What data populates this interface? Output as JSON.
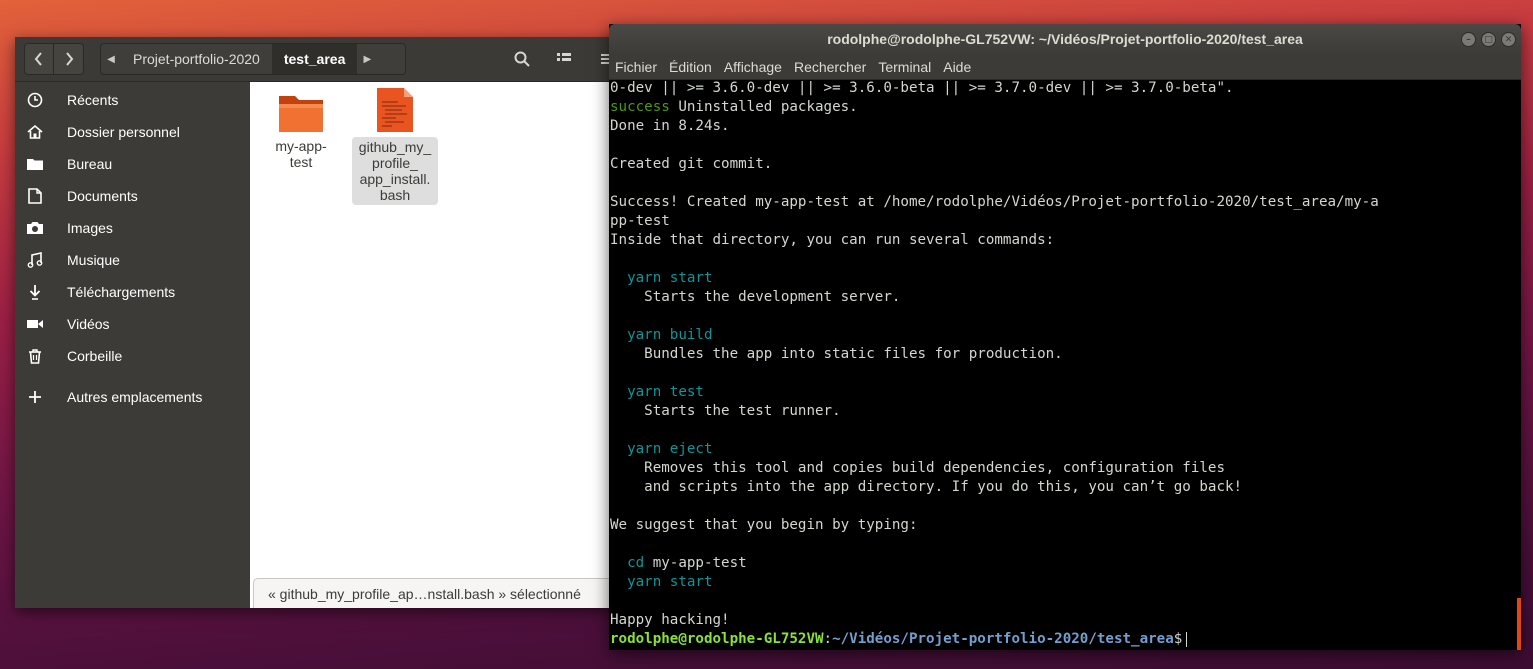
{
  "file_manager": {
    "breadcrumb": [
      "Projet-portfolio-2020",
      "test_area"
    ],
    "sidebar": [
      {
        "label": "Récents",
        "icon": "clock-icon"
      },
      {
        "label": "Dossier personnel",
        "icon": "home-icon"
      },
      {
        "label": "Bureau",
        "icon": "folder-icon"
      },
      {
        "label": "Documents",
        "icon": "document-icon"
      },
      {
        "label": "Images",
        "icon": "camera-icon"
      },
      {
        "label": "Musique",
        "icon": "music-icon"
      },
      {
        "label": "Téléchargements",
        "icon": "download-icon"
      },
      {
        "label": "Vidéos",
        "icon": "video-icon"
      },
      {
        "label": "Corbeille",
        "icon": "trash-icon"
      },
      {
        "label": "Autres emplacements",
        "icon": "plus-icon"
      }
    ],
    "files": [
      {
        "name_line1": "my-app-",
        "name_line2": "test",
        "type": "folder"
      },
      {
        "name_line1": "github_my_",
        "name_line2": "profile_",
        "name_line3": "app_install.",
        "name_line4": "bash",
        "type": "script",
        "selected": true
      }
    ],
    "status": "« github_my_profile_ap…nstall.bash » sélectionné"
  },
  "terminal": {
    "title": "rodolphe@rodolphe-GL752VW: ~/Vidéos/Projet-portfolio-2020/test_area",
    "menu": [
      "Fichier",
      "Édition",
      "Affichage",
      "Rechercher",
      "Terminal",
      "Aide"
    ],
    "lines": {
      "l1": "0-dev || >= 3.6.0-dev || >= 3.6.0-beta || >= 3.7.0-dev || >= 3.7.0-beta\".",
      "l2_kw": "success",
      "l2_rest": " Uninstalled packages.",
      "l3": "Done in 8.24s.",
      "l4": "Created git commit.",
      "l5": "Success! Created my-app-test at /home/rodolphe/Vidéos/Projet-portfolio-2020/test_area/my-a",
      "l6": "pp-test",
      "l7": "Inside that directory, you can run several commands:",
      "start_cmd": "  yarn start",
      "start_desc": "    Starts the development server.",
      "build_cmd": "  yarn build",
      "build_desc": "    Bundles the app into static files for production.",
      "test_cmd": "  yarn test",
      "test_desc": "    Starts the test runner.",
      "eject_cmd": "  yarn eject",
      "eject_desc1": "    Removes this tool and copies build dependencies, configuration files",
      "eject_desc2": "    and scripts into the app directory. If you do this, you can’t go back!",
      "suggest": "We suggest that you begin by typing:",
      "cd_kw": "  cd",
      "cd_rest": " my-app-test",
      "yarn_start2": "  yarn start",
      "happy": "Happy hacking!",
      "prompt_user": "rodolphe@rodolphe-GL752VW",
      "prompt_sep": ":",
      "prompt_path": "~/Vidéos/Projet-portfolio-2020/test_area",
      "prompt_end": "$"
    }
  },
  "colors": {
    "accent": "#dd4814",
    "terminal_bg": "#000000",
    "sidebar_bg": "#3c3b37"
  }
}
